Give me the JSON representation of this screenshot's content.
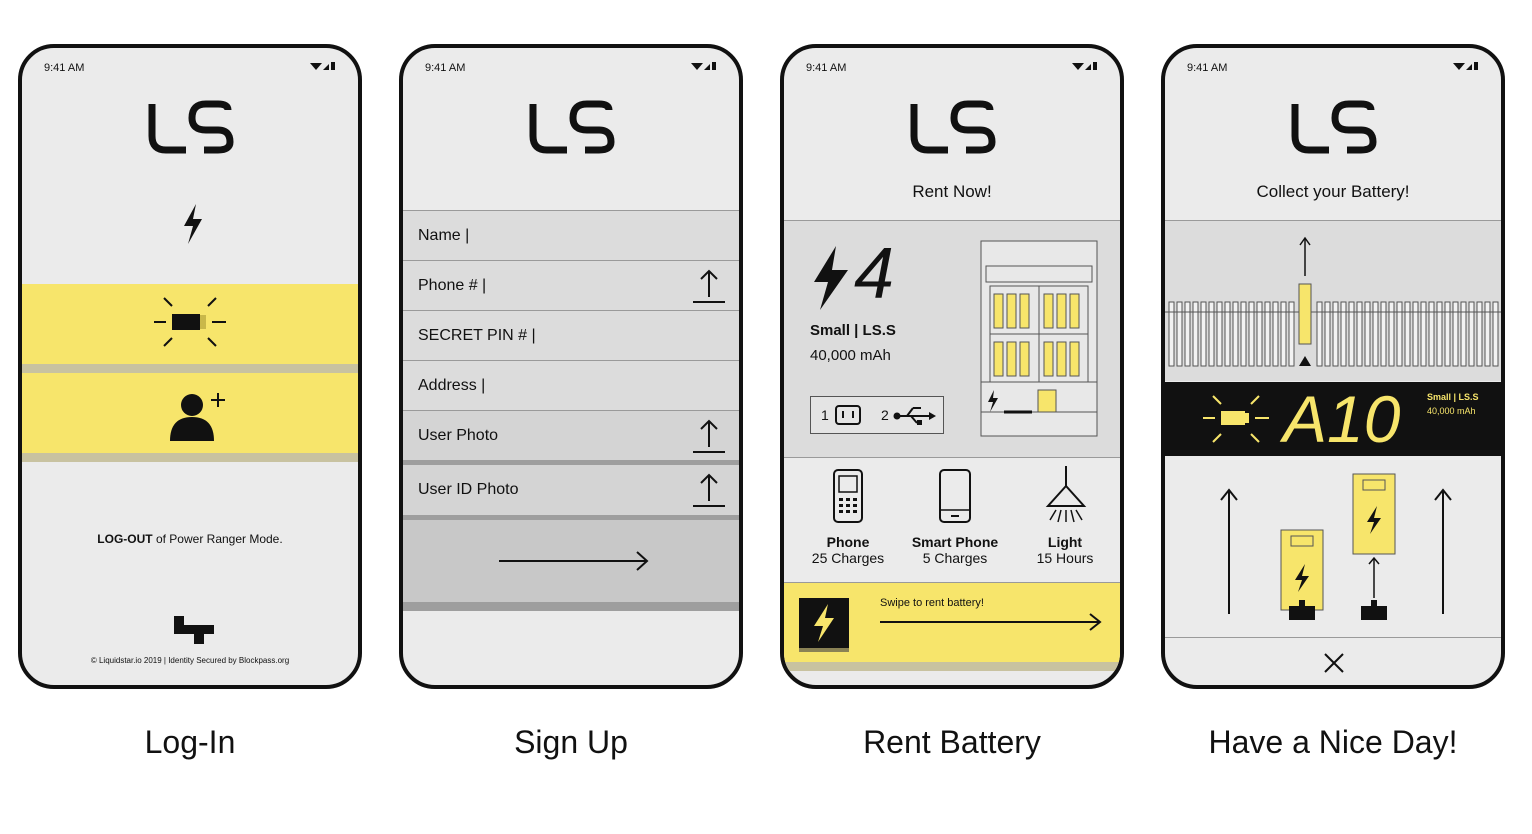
{
  "status": {
    "time": "9:41 AM"
  },
  "screens": {
    "login": {
      "caption": "Log-In",
      "logout_bold": "LOG-OUT",
      "logout_rest": " of Power Ranger Mode.",
      "footer": "© Liquidstar.io 2019 | Identity Secured by Blockpass.org"
    },
    "signup": {
      "caption": "Sign Up",
      "fields": [
        "Name |",
        "Phone # |",
        "SECRET PIN # |",
        "Address |",
        "User Photo",
        "User ID Photo"
      ]
    },
    "rent": {
      "caption": "Rent Battery",
      "title": "Rent Now!",
      "count": "4",
      "size": "Small | LS.S",
      "capacity": "40,000 mAh",
      "port1": "1",
      "port2": "2",
      "items": [
        {
          "name": "Phone",
          "value": "25 Charges"
        },
        {
          "name": "Smart Phone",
          "value": "5 Charges"
        },
        {
          "name": "Light",
          "value": "15 Hours"
        }
      ],
      "swipe": "Swipe to rent battery!"
    },
    "collect": {
      "caption": "Have a Nice Day!",
      "title": "Collect your Battery!",
      "slot": "A10",
      "size": "Small | LS.S",
      "capacity": "40,000 mAh"
    }
  },
  "colors": {
    "accent": "#f7e56b",
    "dark": "#111111",
    "screen": "#ebebeb"
  }
}
